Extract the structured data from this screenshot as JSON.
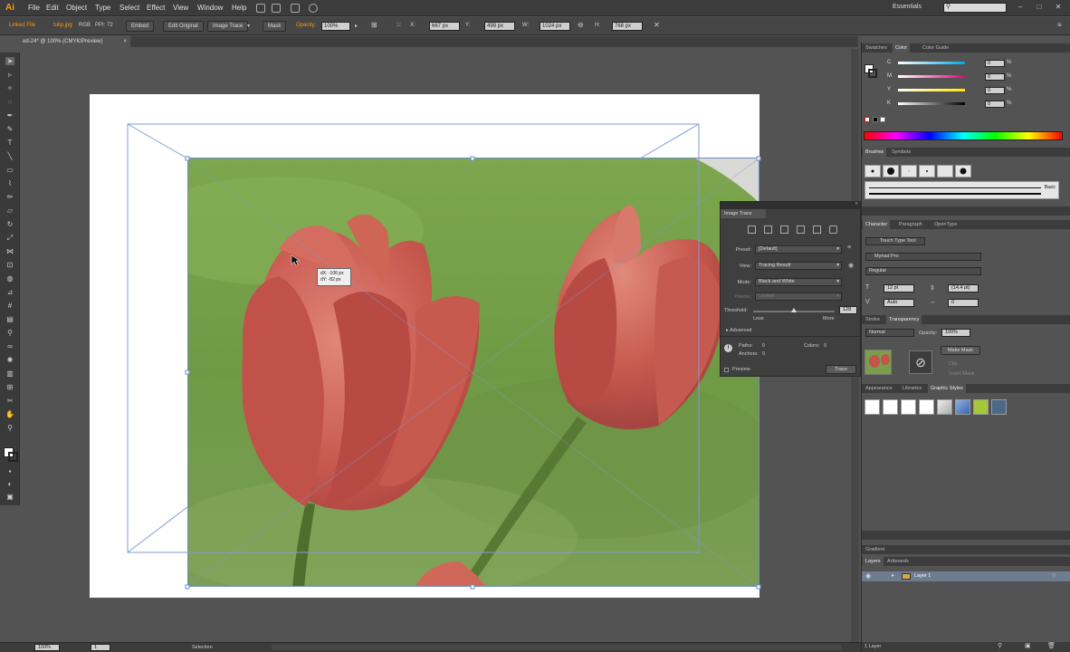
{
  "app": {
    "logo": "Ai",
    "menus": [
      "File",
      "Edit",
      "Object",
      "Type",
      "Select",
      "Effect",
      "View",
      "Window",
      "Help"
    ],
    "workspace": "Essentials",
    "window_buttons": [
      "–",
      "□",
      "✕"
    ]
  },
  "control_bar": {
    "selection_type": "Linked File",
    "file_name": "tulip.jpg",
    "color_mode": "RGB",
    "ppi": "PPI: 72",
    "embed_label": "Embed",
    "edit_original_label": "Edit Original",
    "image_trace_label": "Image Trace",
    "mask_label": "Mask",
    "opacity_label": "Opacity:",
    "opacity_value": "100%",
    "x_label": "X:",
    "x_value": "667 px",
    "y_label": "Y:",
    "y_value": "499 px",
    "w_label": "W:",
    "w_value": "1024 px",
    "h_label": "H:",
    "h_value": "768 px"
  },
  "document": {
    "tab_title": "ed-24* @ 100% (CMYK/Preview)",
    "tab_close": "×"
  },
  "canvas": {
    "tooltip_dx": "dX: -106 px",
    "tooltip_dy": "dY: -82 px"
  },
  "image_trace": {
    "title": "Image Trace",
    "preset_label": "Preset:",
    "preset_value": "[Default]",
    "view_label": "View:",
    "view_value": "Tracing Result",
    "mode_label": "Mode:",
    "mode_value": "Black and White",
    "palette_label": "Palette:",
    "palette_value": "Limited",
    "threshold_label": "Threshold:",
    "threshold_value": "128",
    "threshold_level": 0.5,
    "less_label": "Less",
    "more_label": "More",
    "advanced_label": "Advanced",
    "paths_label": "Paths:",
    "paths_value": "0",
    "colors_label": "Colors:",
    "colors_value": "0",
    "anchors_label": "Anchors:",
    "anchors_value": "0",
    "preview_label": "Preview",
    "trace_label": "Trace"
  },
  "color_panel": {
    "tabs": [
      "Swatches",
      "Color",
      "Color Guide"
    ],
    "channels": [
      {
        "label": "C",
        "value": "0"
      },
      {
        "label": "M",
        "value": "0"
      },
      {
        "label": "Y",
        "value": "0"
      },
      {
        "label": "K",
        "value": "0"
      }
    ],
    "pct": "%",
    "channel_colors": [
      "#00a6e6",
      "#e6007e",
      "#ffe600",
      "#ffffff"
    ]
  },
  "brushes_panel": {
    "tabs": [
      "Brushes",
      "Symbols"
    ],
    "basic_label": "Basic"
  },
  "character_panel": {
    "tabs": [
      "Character",
      "Paragraph",
      "OpenType"
    ],
    "touch_type_label": "Touch Type Tool",
    "font_value": "Myriad Pro",
    "style_value": "Regular",
    "size_value": "12 pt",
    "leading_value": "(14.4 pt)",
    "kerning_value": "Auto",
    "tracking_value": "0"
  },
  "transparency_panel": {
    "tabs": [
      "Stroke",
      "Transparency"
    ],
    "blend_value": "Normal",
    "opacity_label": "Opacity:",
    "opacity_value": "100%",
    "make_mask_label": "Make Mask",
    "clip_label": "Clip",
    "invert_mask_label": "Invert Mask"
  },
  "graphic_styles_panel": {
    "tabs": [
      "Appearance",
      "Libraries",
      "Graphic Styles"
    ]
  },
  "gradient_panel": {
    "title": "Gradient"
  },
  "layers_panel": {
    "tabs": [
      "Layers",
      "Artboards"
    ],
    "layer_name": "Layer 1",
    "footer": "1 Layer"
  },
  "status_bar": {
    "zoom": "100%",
    "artboard_num": "1",
    "tool_name": "Selection"
  }
}
